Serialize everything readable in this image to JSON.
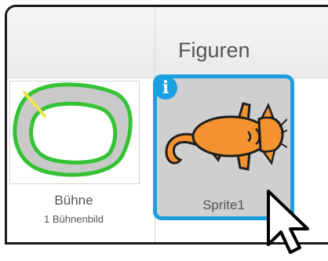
{
  "panel": {
    "sprites_title": "Figuren"
  },
  "stage": {
    "name": "Bühne",
    "backdrop_count": "1 Bühnenbild"
  },
  "sprite": {
    "name": "Sprite1",
    "info_icon_glyph": "i",
    "selected": true
  },
  "colors": {
    "selection": "#1a9fe0",
    "tile_background": "#cfcfcf"
  },
  "icons": [
    "info-icon",
    "mouse-pointer-icon"
  ]
}
